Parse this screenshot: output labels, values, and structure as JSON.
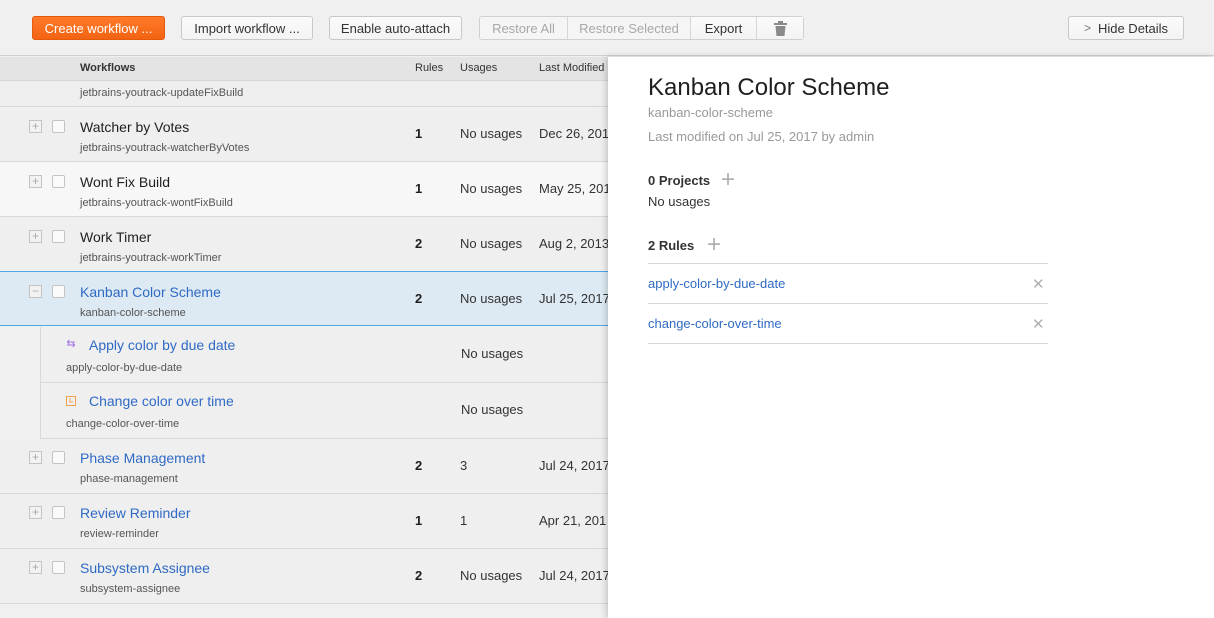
{
  "toolbar": {
    "create_workflow": "Create workflow ...",
    "import_workflow": "Import workflow ...",
    "enable_auto_attach": "Enable auto-attach",
    "restore_all": "Restore All",
    "restore_selected": "Restore Selected",
    "export": "Export",
    "delete_icon": "trash-icon",
    "hide_details": "Hide Details",
    "hide_details_icon": "chevron-right-icon",
    "accent_color": "#f26412"
  },
  "table": {
    "columns": [
      "Workflows",
      "Rules",
      "Usages",
      "Last Modified"
    ],
    "partial_row": {
      "id": "jetbrains-youtrack-updateFixBuild"
    },
    "rows": [
      {
        "title": "Watcher by Votes",
        "id": "jetbrains-youtrack-watcherByVotes",
        "rules": "1",
        "usages": "No usages",
        "modified": "Dec 26, 201"
      },
      {
        "title": "Wont Fix Build",
        "id": "jetbrains-youtrack-wontFixBuild",
        "rules": "1",
        "usages": "No usages",
        "modified": "May 25, 201"
      },
      {
        "title": "Work Timer",
        "id": "jetbrains-youtrack-workTimer",
        "rules": "2",
        "usages": "No usages",
        "modified": "Aug 2, 2013"
      },
      {
        "title": "Kanban Color Scheme",
        "id": "kanban-color-scheme",
        "rules": "2",
        "usages": "No usages",
        "modified": "Jul 25, 2017",
        "selected": true
      },
      {
        "title": "Phase Management",
        "id": "phase-management",
        "rules": "2",
        "usages": "3",
        "modified": "Jul 24, 2017"
      },
      {
        "title": "Review Reminder",
        "id": "review-reminder",
        "rules": "1",
        "usages": "1",
        "modified": "Apr 21, 201"
      },
      {
        "title": "Subsystem Assignee",
        "id": "subsystem-assignee",
        "rules": "2",
        "usages": "No usages",
        "modified": "Jul 24, 2017"
      }
    ],
    "subrows": [
      {
        "title": "Apply color by due date",
        "id": "apply-color-by-due-date",
        "usages": "No usages",
        "icon": "on-change-rule-icon",
        "icon_color": "#a070e0"
      },
      {
        "title": "Change color over time",
        "id": "change-color-over-time",
        "usages": "No usages",
        "icon": "on-schedule-rule-icon",
        "icon_color": "#f5a050"
      }
    ]
  },
  "details": {
    "title": "Kanban Color Scheme",
    "id": "kanban-color-scheme",
    "last_modified": "Last modified on Jul 25, 2017 by admin",
    "projects_label": "0 Projects",
    "projects_empty": "No usages",
    "rules_label": "2 Rules",
    "rules": [
      "apply-color-by-due-date",
      "change-color-over-time"
    ]
  }
}
